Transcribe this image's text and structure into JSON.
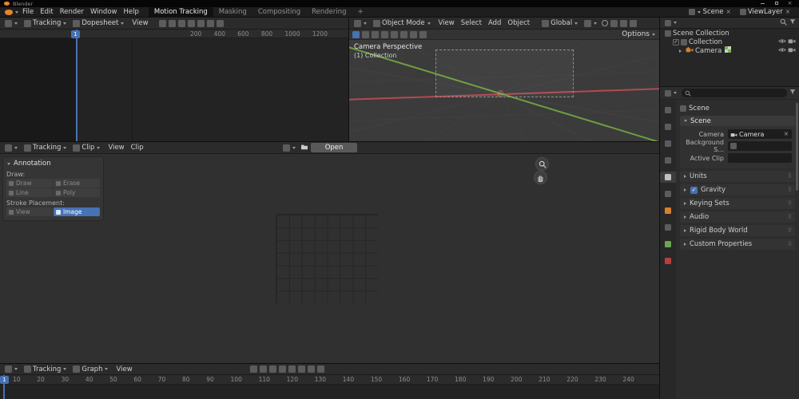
{
  "accent": "#4772b3",
  "titlebar": {
    "app": "Blender"
  },
  "menubar": {
    "menus": [
      "File",
      "Edit",
      "Render",
      "Window",
      "Help"
    ],
    "tabs": [
      {
        "label": "Motion Tracking",
        "active": true
      },
      {
        "label": "Masking",
        "active": false
      },
      {
        "label": "Compositing",
        "active": false
      },
      {
        "label": "Rendering",
        "active": false
      },
      {
        "label": "+",
        "active": false
      }
    ],
    "scene_selector": {
      "label": "Scene"
    },
    "viewlayer_selector": {
      "label": "ViewLayer"
    }
  },
  "dopesheet": {
    "mode": "Tracking",
    "editor": "Dopesheet",
    "view_menu": "View",
    "current_frame": "1",
    "ruler": [
      "200",
      "400",
      "600",
      "800",
      "1000",
      "1200"
    ]
  },
  "viewport": {
    "interaction_mode": "Object Mode",
    "menus": [
      "View",
      "Select",
      "Add",
      "Object"
    ],
    "orientation": "Global",
    "options_label": "Options",
    "overlay_line1": "Camera Perspective",
    "overlay_line2": "(1) Collection"
  },
  "outliner": {
    "items": [
      {
        "label": "Scene Collection"
      },
      {
        "label": "Collection"
      },
      {
        "label": "Camera"
      }
    ]
  },
  "properties": {
    "breadcrumb": "Scene",
    "section_title": "Scene",
    "fields": [
      {
        "label": "Camera",
        "value": "Camera"
      },
      {
        "label": "Background S...",
        "value": ""
      },
      {
        "label": "Active Clip",
        "value": ""
      }
    ],
    "gravity_checked": true,
    "panels": [
      {
        "label": "Units"
      },
      {
        "label": "Gravity"
      },
      {
        "label": "Keying Sets"
      },
      {
        "label": "Audio"
      },
      {
        "label": "Rigid Body World"
      },
      {
        "label": "Custom Properties"
      }
    ]
  },
  "clip": {
    "mode": "Tracking",
    "editor": "Clip",
    "menus": [
      "View",
      "Clip"
    ],
    "open_label": "Open",
    "annotation": {
      "title": "Annotation",
      "draw_label": "Draw:",
      "tools": [
        "Draw",
        "Erase",
        "Line",
        "Poly"
      ],
      "placement_label": "Stroke Placement:",
      "placement_options": [
        "View",
        "Image"
      ],
      "placement_active": "Image"
    }
  },
  "graph": {
    "mode": "Tracking",
    "editor": "Graph",
    "view_menu": "View",
    "current_frame": "1",
    "ruler": [
      "10",
      "20",
      "30",
      "40",
      "50",
      "60",
      "70",
      "80",
      "90",
      "100",
      "110",
      "120",
      "130",
      "140",
      "150",
      "160",
      "170",
      "180",
      "190",
      "200",
      "210",
      "220",
      "230",
      "240"
    ]
  }
}
